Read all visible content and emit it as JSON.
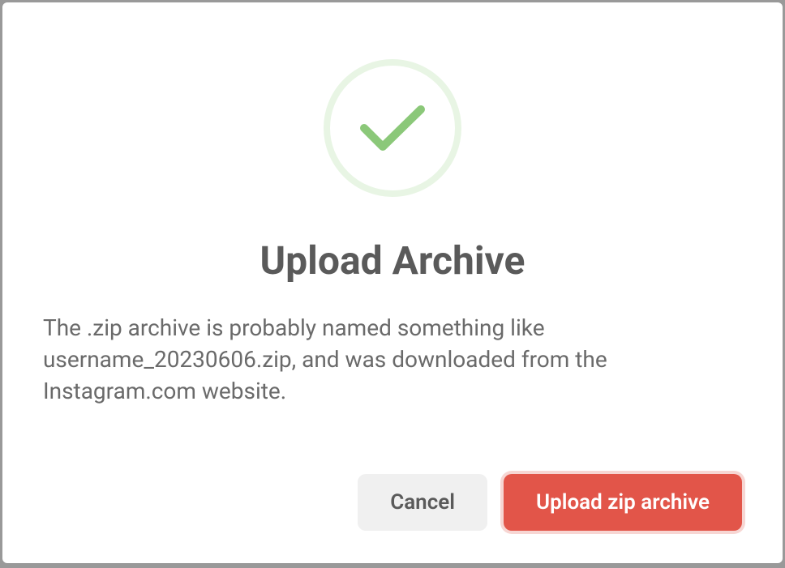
{
  "dialog": {
    "title": "Upload Archive",
    "description": "The .zip archive is probably named something like username_20230606.zip, and was downloaded from the Instagram.com website.",
    "buttons": {
      "cancel": "Cancel",
      "upload": "Upload zip archive"
    },
    "icon": "checkmark-success"
  },
  "colors": {
    "success_stroke": "#8bc879",
    "success_ring": "#e8f5e4",
    "primary_button": "#e25549",
    "primary_focus_ring": "#f7d6d3",
    "cancel_button": "#f0f0f0",
    "text_title": "#5a5a5a",
    "text_body": "#6a6a6a"
  }
}
